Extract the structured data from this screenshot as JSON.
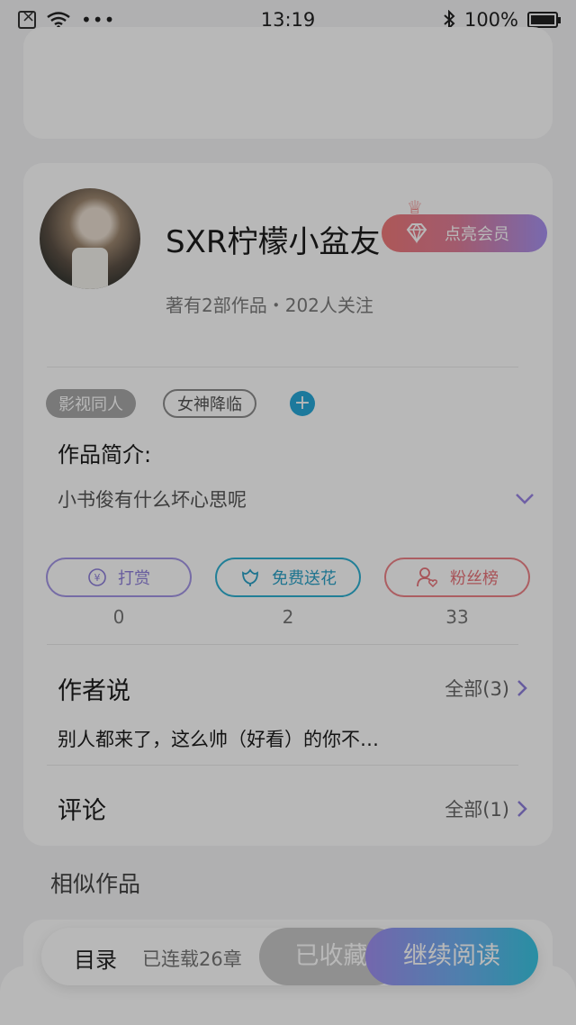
{
  "status_bar": {
    "time": "13:19",
    "battery": "100%"
  },
  "author": {
    "name": "SXR柠檬小盆友",
    "stats": "著有2部作品・202人关注"
  },
  "vip": {
    "label": "点亮会员"
  },
  "tags": [
    "影视同人",
    "女神降临"
  ],
  "intro": {
    "title": "作品简介:",
    "text": "小书俊有什么坏心思呢"
  },
  "actions": {
    "reward": {
      "label": "打赏",
      "count": "0"
    },
    "flower": {
      "label": "免费送花",
      "count": "2"
    },
    "fans": {
      "label": "粉丝榜",
      "count": "33"
    }
  },
  "author_says": {
    "title": "作者说",
    "link": "全部(3)",
    "text": "别人都来了，这么帅（好看）的你不…"
  },
  "comments": {
    "title": "评论",
    "link": "全部(1)"
  },
  "similar": {
    "title": "相似作品"
  },
  "bottom_bar": {
    "toc": "目录",
    "serial": "已连载26章",
    "collected": "已收藏",
    "continue_read": "继续阅读"
  },
  "colors": {
    "reward": "#8f80dc",
    "flower": "#2aa1c7",
    "fans": "#e9737a",
    "vip_start": "#f07a7a",
    "vip_end": "#a792f2",
    "tag_add": "#27a8d8"
  }
}
